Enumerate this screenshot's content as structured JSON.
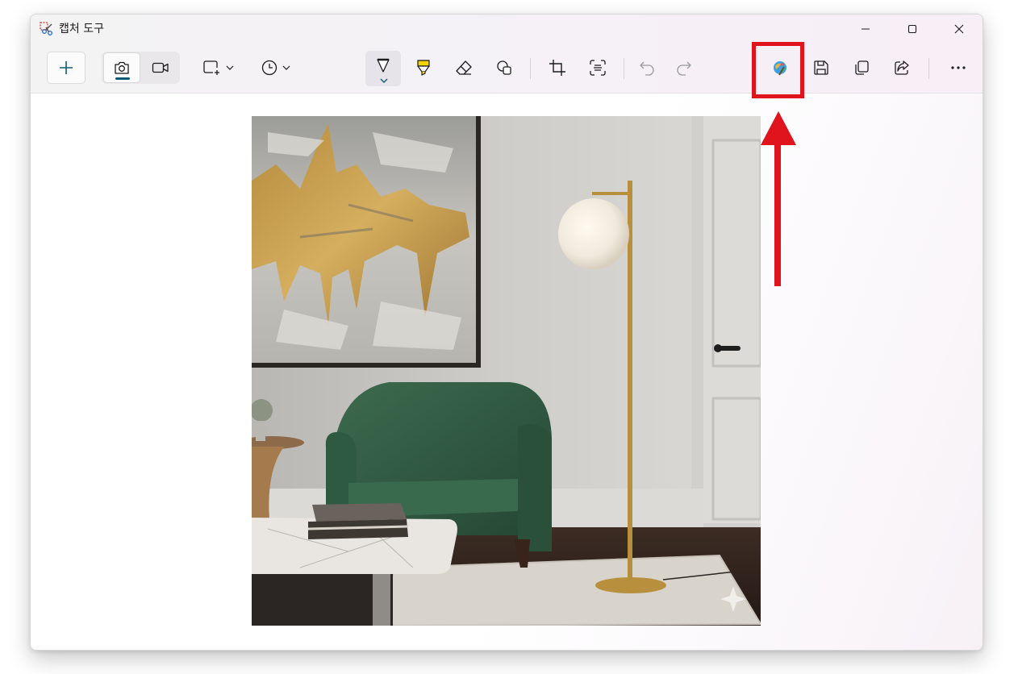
{
  "window": {
    "title": "캡처 도구"
  },
  "toolbar": {
    "new": "new-capture",
    "modes": [
      "snip-mode-photo",
      "snip-mode-video"
    ],
    "shape": "rectangle-snip",
    "delay": "delay-timer",
    "tools": [
      "ballpoint-pen",
      "highlighter",
      "eraser",
      "shapes",
      "crop",
      "text-actions",
      "undo",
      "redo",
      "paint-edit",
      "save",
      "copy",
      "share",
      "more"
    ]
  },
  "colors": {
    "accent": "#0f5b78",
    "annotation": "#e0141c",
    "highlighter": "#f5d400"
  }
}
